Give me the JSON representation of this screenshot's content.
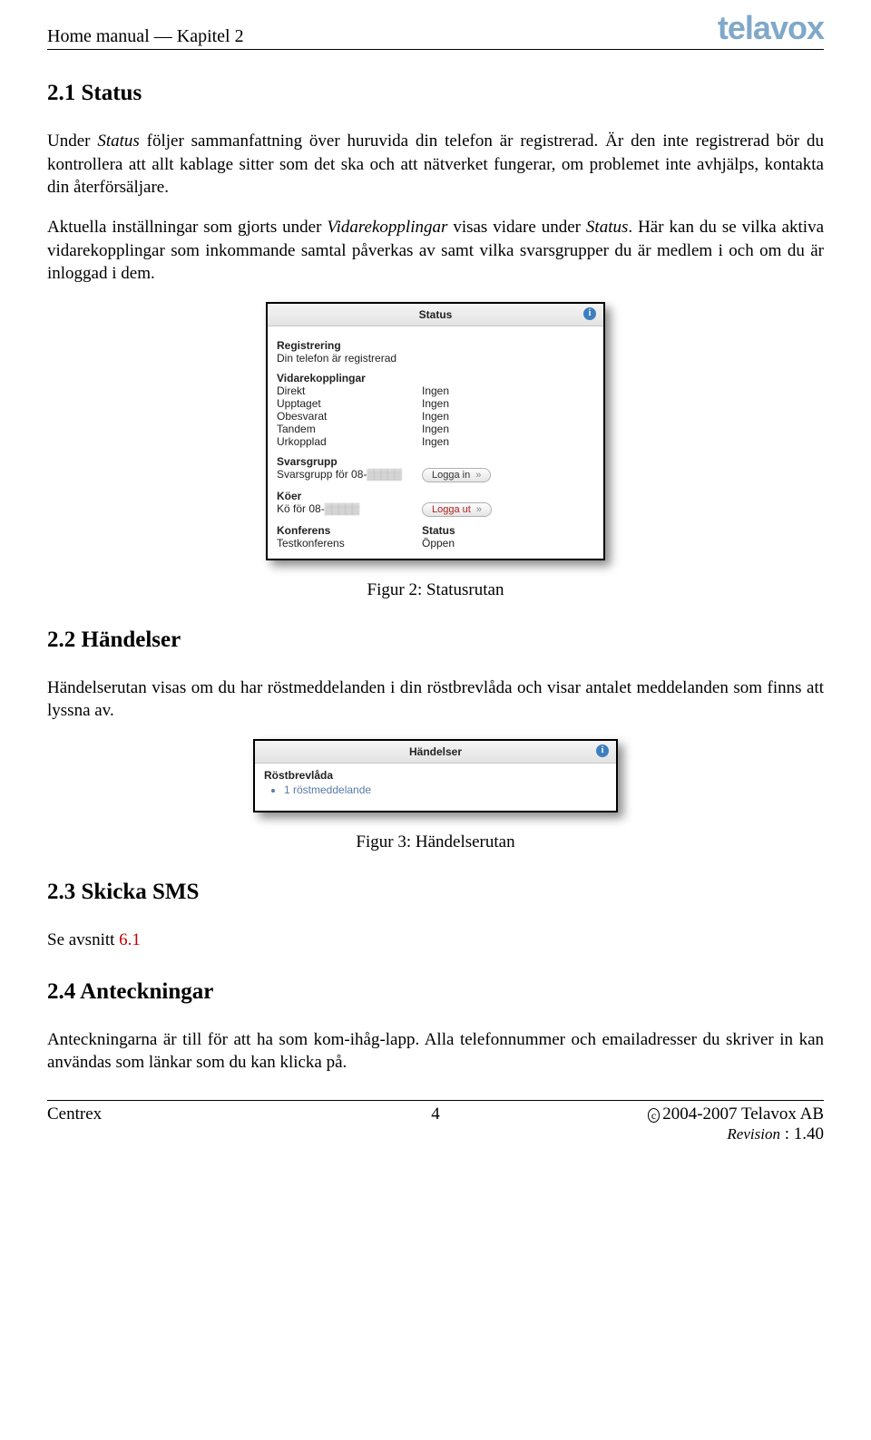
{
  "header": {
    "left": "Home manual — Kapitel 2",
    "logo": "telavox"
  },
  "s21": {
    "heading": "2.1   Status",
    "p1_a": "Under ",
    "p1_i1": "Status",
    "p1_b": " följer sammanfattning över huruvida din telefon är registrerad. Är den inte registrerad bör du kontrollera att allt kablage sitter som det ska och att nätverket fungerar, om problemet inte avhjälps, kontakta din återförsäljare.",
    "p2_a": "Aktuella inställningar som gjorts under ",
    "p2_i1": "Vidarekopplingar",
    "p2_b": " visas vidare under ",
    "p2_i2": "Status",
    "p2_c": ". Här kan du se vilka aktiva vidarekopplingar som inkommande samtal påverkas av samt vilka svarsgrupper du är medlem i och om du är inloggad i dem."
  },
  "fig2": {
    "title": "Status",
    "registrering_h": "Registrering",
    "registrering_v": "Din telefon är registrerad",
    "vidare_h": "Vidarekopplingar",
    "rows": [
      {
        "k": "Direkt",
        "v": "Ingen"
      },
      {
        "k": "Upptaget",
        "v": "Ingen"
      },
      {
        "k": "Obesvarat",
        "v": "Ingen"
      },
      {
        "k": "Tandem",
        "v": "Ingen"
      },
      {
        "k": "Urkopplad",
        "v": "Ingen"
      }
    ],
    "svars_h": "Svarsgrupp",
    "svars_row_label": "Svarsgrupp för 08-",
    "svars_btn": "Logga in",
    "koer_h": "Köer",
    "koer_row_label": "Kö för 08-",
    "koer_btn": "Logga ut",
    "konf_h": "Konferens",
    "konf_status_h": "Status",
    "konf_row_k": "Testkonferens",
    "konf_row_v": "Öppen",
    "caption": "Figur 2: Statusrutan"
  },
  "s22": {
    "heading": "2.2   Händelser",
    "p1": "Händelserutan visas om du har röstmeddelanden i din röstbrevlåda och visar antalet meddelanden som finns att lyssna av."
  },
  "fig3": {
    "title": "Händelser",
    "rost_h": "Röstbrevlåda",
    "item": "1 röstmeddelande",
    "caption": "Figur 3: Händelserutan"
  },
  "s23": {
    "heading": "2.3   Skicka SMS",
    "p_a": "Se avsnitt ",
    "ref": "6.1"
  },
  "s24": {
    "heading": "2.4   Anteckningar",
    "p1": "Anteckningarna är till för att ha som kom-ihåg-lapp. Alla telefonnummer och emailadresser du skriver in kan användas som länkar som du kan klicka på."
  },
  "footer": {
    "left": "Centrex",
    "page": "4",
    "copy": "2004-2007 Telavox AB",
    "rev_label": "Revision",
    "rev_val": " : 1.40"
  }
}
